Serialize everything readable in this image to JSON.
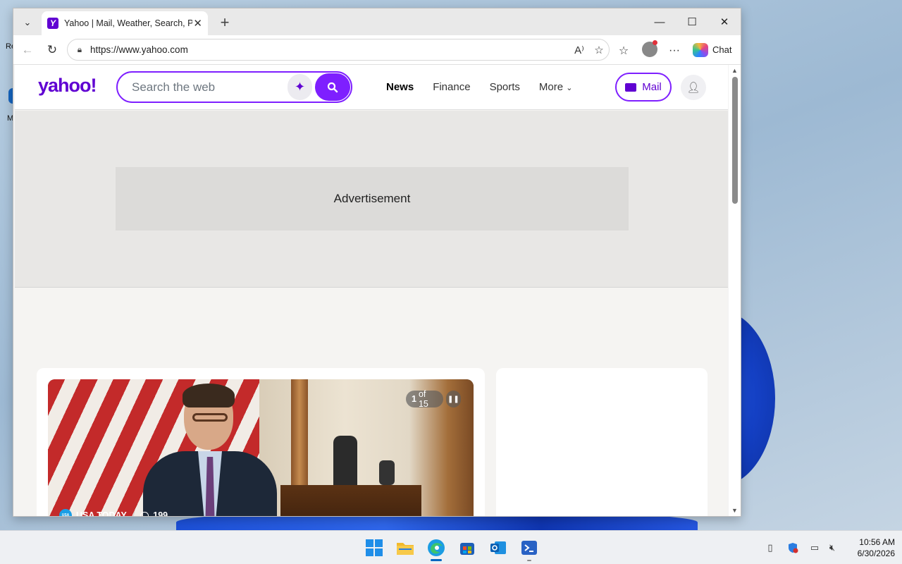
{
  "browser": {
    "tab_title": "Yahoo | Mail, Weather, Search, Politics",
    "url": "https://www.yahoo.com",
    "chat_label": "Chat"
  },
  "yahoo": {
    "logo": "yahoo!",
    "search_placeholder": "Search the web",
    "nav": [
      {
        "label": "News",
        "active": true
      },
      {
        "label": "Finance",
        "active": false
      },
      {
        "label": "Sports",
        "active": false
      },
      {
        "label": "More",
        "active": false
      }
    ],
    "mail_label": "Mail",
    "advertisement_label": "Advertisement",
    "slideshow": {
      "current": "1",
      "of_total": "of 15",
      "source": "USA TODAY",
      "comments": "199"
    },
    "colors": {
      "brand": "#6001d2",
      "accent": "#7e1fff"
    }
  },
  "taskbar": {
    "apps": [
      "start-icon",
      "file-explorer-icon",
      "edge-icon",
      "store-icon",
      "outlook-icon",
      "terminal-icon"
    ],
    "time": "10:56 AM",
    "date": "6/30/2026"
  }
}
